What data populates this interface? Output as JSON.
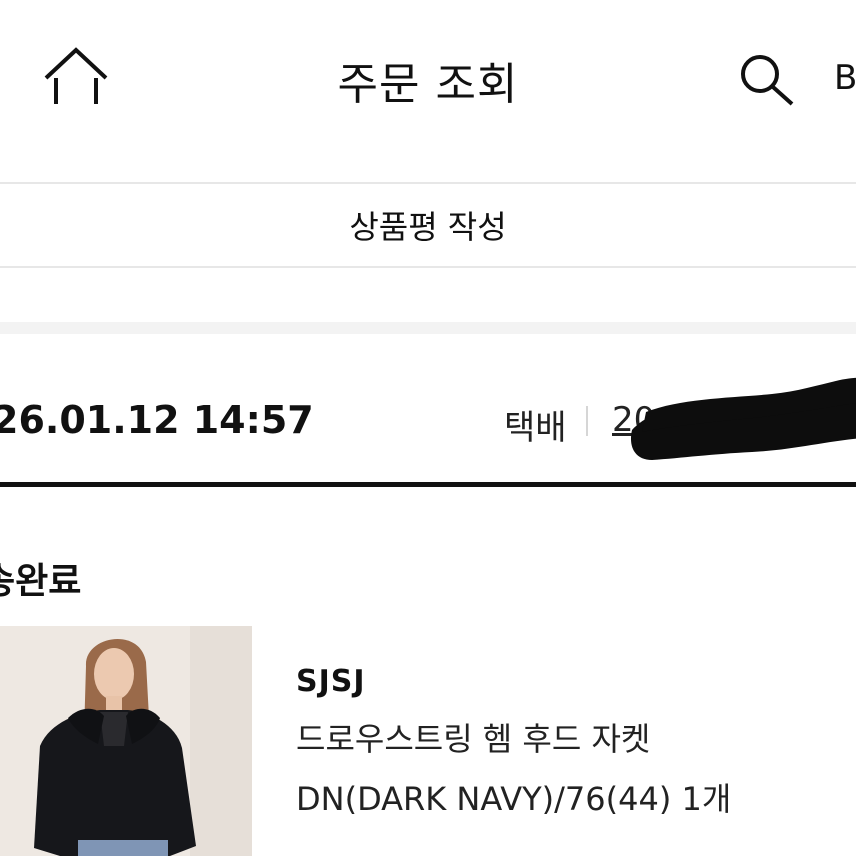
{
  "header": {
    "title": "주문 조회",
    "right_cutoff_text": "B",
    "icons": {
      "home": "home-icon",
      "search": "search-icon"
    }
  },
  "actions": {
    "review_label": "상품평 작성"
  },
  "order": {
    "date": "26.01.12 14:57",
    "delivery_method": "택배",
    "tracking_number": "20",
    "status": "송완료"
  },
  "product": {
    "brand": "SJSJ",
    "name": "드로우스트링 헴 후드 자켓",
    "option": "DN(DARK NAVY)/76(44)",
    "quantity": "1개"
  }
}
